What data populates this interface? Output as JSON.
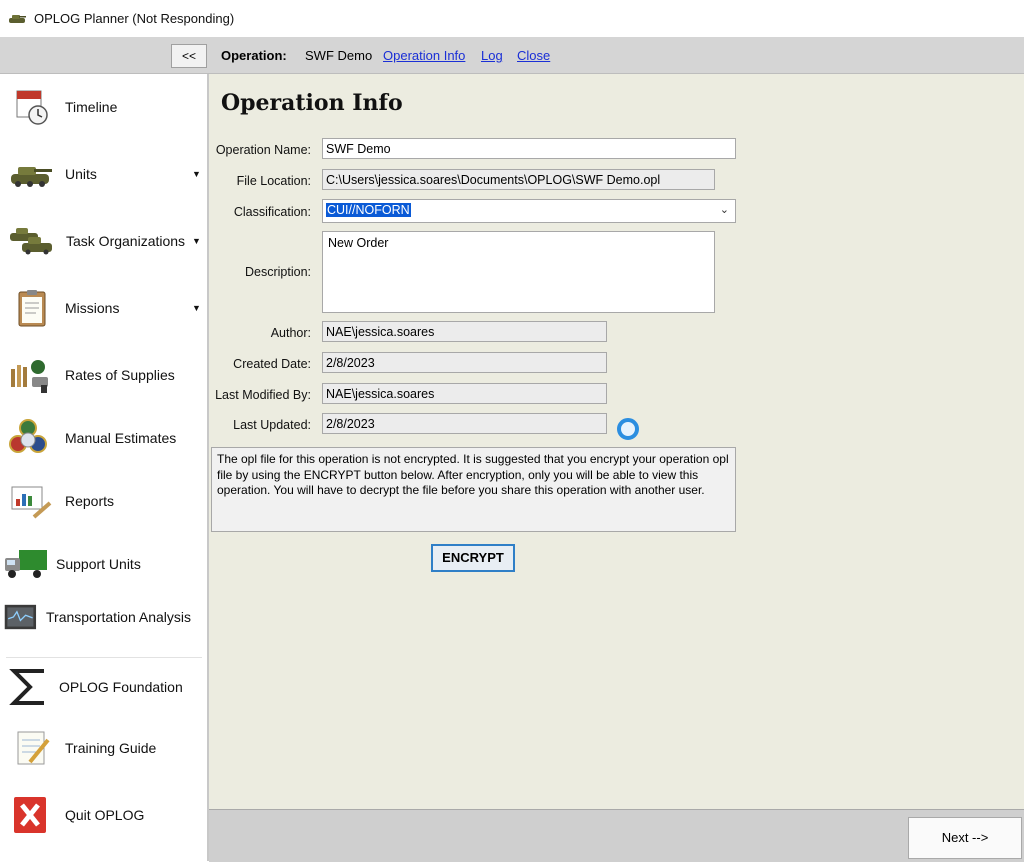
{
  "window": {
    "title": "OPLOG Planner (Not Responding)"
  },
  "navbar": {
    "collapse_label": "<<",
    "operation_label": "Operation:",
    "operation_name": "SWF Demo",
    "links": [
      "Operation Info",
      "Log",
      "Close"
    ]
  },
  "sidebar": {
    "items": [
      {
        "label": "Timeline",
        "icon": "calendar-clock-icon",
        "has_dropdown": false
      },
      {
        "label": "Units",
        "icon": "tank-icon",
        "has_dropdown": true
      },
      {
        "label": "Task Organizations",
        "icon": "tanks-icon",
        "has_dropdown": true
      },
      {
        "label": "Missions",
        "icon": "clipboard-icon",
        "has_dropdown": true
      },
      {
        "label": "Rates of Supplies",
        "icon": "supplies-icon",
        "has_dropdown": false
      },
      {
        "label": "Manual Estimates",
        "icon": "emblems-icon",
        "has_dropdown": false
      },
      {
        "label": "Reports",
        "icon": "presentation-icon",
        "has_dropdown": false
      },
      {
        "label": "Support Units",
        "icon": "truck-icon",
        "has_dropdown": false
      },
      {
        "label": "Transportation Analysis",
        "icon": "monitor-chart-icon",
        "has_dropdown": false
      },
      {
        "label": "OPLOG Foundation",
        "icon": "sigma-icon",
        "has_dropdown": false
      },
      {
        "label": "Training Guide",
        "icon": "notepad-pen-icon",
        "has_dropdown": false
      },
      {
        "label": "Quit OPLOG",
        "icon": "quit-x-icon",
        "has_dropdown": false
      }
    ]
  },
  "main": {
    "title": "Operation Info",
    "fields": {
      "operation_name": {
        "label": "Operation Name:",
        "value": "SWF Demo"
      },
      "file_location": {
        "label": "File Location:",
        "value": "C:\\Users\\jessica.soares\\Documents\\OPLOG\\SWF Demo.opl"
      },
      "classification": {
        "label": "Classification:",
        "value": "CUI//NOFORN"
      },
      "description": {
        "label": "Description:",
        "value": "New Order"
      },
      "author": {
        "label": "Author:",
        "value": "NAE\\jessica.soares"
      },
      "created_date": {
        "label": "Created Date:",
        "value": "2/8/2023"
      },
      "last_modified_by": {
        "label": "Last Modified By:",
        "value": "NAE\\jessica.soares"
      },
      "last_updated": {
        "label": "Last Updated:",
        "value": "2/8/2023"
      }
    },
    "notice": "The opl file for this operation is not encrypted. It is suggested that you encrypt your operation opl file by using the ENCRYPT button below. After encryption, only you will be able to view this operation. You will have to decrypt the file before you share this operation with another user.",
    "encrypt_label": "ENCRYPT"
  },
  "footer": {
    "next_label": "Next  -->"
  },
  "colors": {
    "main_bg": "#ecece0",
    "link": "#1a2fd6",
    "selection": "#0a5ad6",
    "button_focus": "#2f7fc7"
  }
}
